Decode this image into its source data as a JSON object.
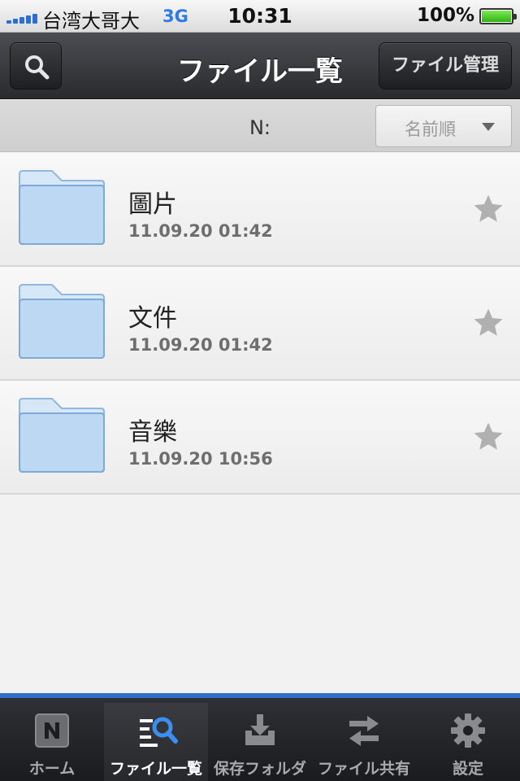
{
  "status": {
    "carrier": "台湾大哥大",
    "network": "3G",
    "time": "10:31",
    "battery": "100%",
    "battery_level": 1.0,
    "signal_bars": 5
  },
  "navbar": {
    "title": "ファイル一覧",
    "manage_button": "ファイル管理",
    "search_icon": "search-icon"
  },
  "subbar": {
    "path": "N:",
    "sort_label": "名前順"
  },
  "files": [
    {
      "name": "圖片",
      "date": "11.09.20 01:42",
      "icon": "folder-icon",
      "favorite_icon": "star-icon"
    },
    {
      "name": "文件",
      "date": "11.09.20 01:42",
      "icon": "folder-icon",
      "favorite_icon": "star-icon"
    },
    {
      "name": "音樂",
      "date": "11.09.20 10:56",
      "icon": "folder-icon",
      "favorite_icon": "star-icon"
    }
  ],
  "tabs": [
    {
      "label": "ホーム",
      "icon": "home-n-icon",
      "active": false
    },
    {
      "label": "ファイル一覧",
      "icon": "file-list-icon",
      "active": true
    },
    {
      "label": "保存フォルダ",
      "icon": "download-tray-icon",
      "active": false
    },
    {
      "label": "ファイル共有",
      "icon": "share-arrows-icon",
      "active": false
    },
    {
      "label": "設定",
      "icon": "gear-icon",
      "active": false
    }
  ],
  "colors": {
    "accent": "#2f6fc8",
    "navbar": "#2a2b2f",
    "folder": "#bcd8f2",
    "star": "#b0b0b0"
  }
}
